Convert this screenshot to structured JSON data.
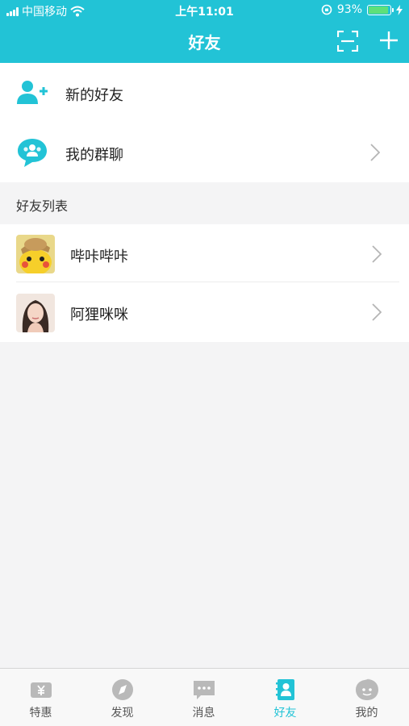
{
  "status_bar": {
    "carrier": "中国移动",
    "time": "上午11:01",
    "battery_text": "93%",
    "battery_level": 0.93
  },
  "nav": {
    "title": "好友",
    "scan_icon": "scan-icon",
    "add_icon": "plus-icon",
    "color": "#22c3d6"
  },
  "menu": {
    "new_friends": {
      "label": "新的好友",
      "icon": "add-user-icon"
    },
    "my_groups": {
      "label": "我的群聊",
      "icon": "group-chat-icon"
    }
  },
  "friends_section": {
    "title": "好友列表",
    "items": [
      {
        "name": "哔咔哔咔",
        "avatar": "pikachu-avatar"
      },
      {
        "name": "阿狸咪咪",
        "avatar": "girl-portrait-avatar"
      }
    ]
  },
  "tabbar": {
    "active_color": "#22c3d6",
    "items": [
      {
        "label": "特惠",
        "icon": "coupon-icon",
        "active": false
      },
      {
        "label": "发现",
        "icon": "compass-icon",
        "active": false
      },
      {
        "label": "消息",
        "icon": "chat-bubble-icon",
        "active": false
      },
      {
        "label": "好友",
        "icon": "contacts-icon",
        "active": true
      },
      {
        "label": "我的",
        "icon": "profile-face-icon",
        "active": false
      }
    ]
  }
}
